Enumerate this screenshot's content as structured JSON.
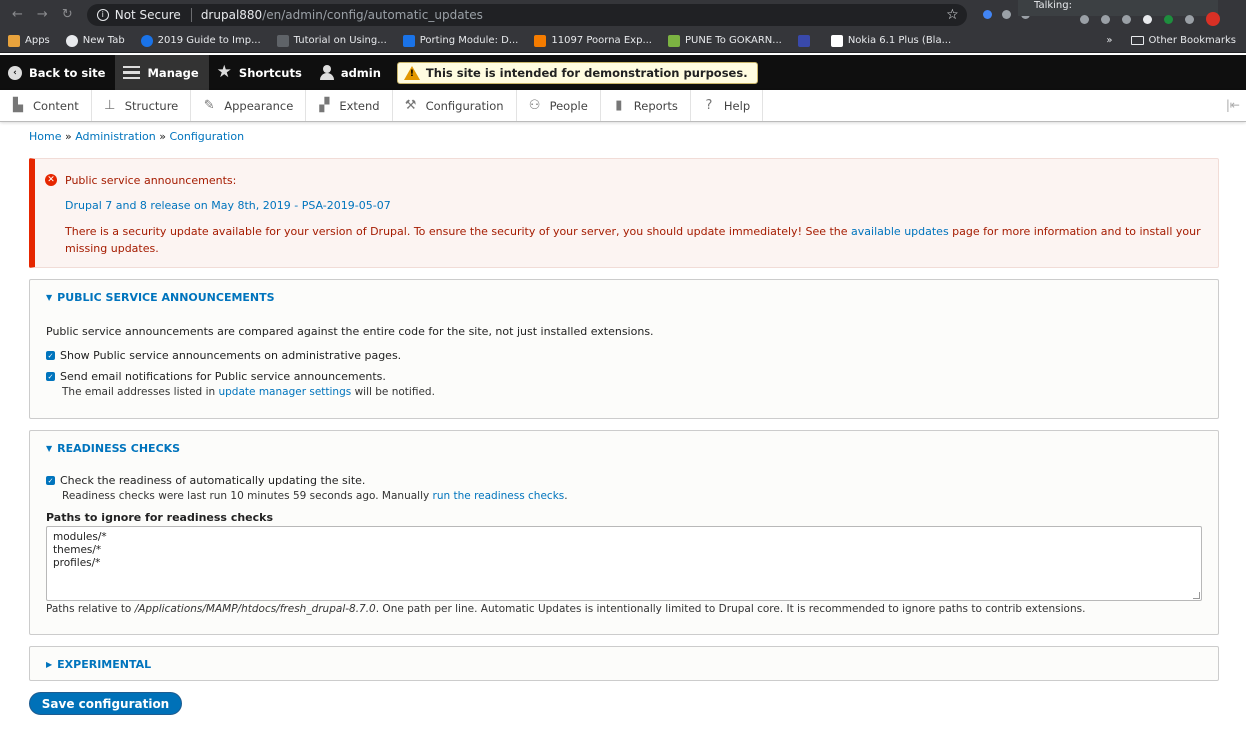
{
  "browser": {
    "not_secure": "Not Secure",
    "url_host": "drupal880",
    "url_path": "/en/admin/config/automatic_updates",
    "talking_label": "Talking:",
    "bookmarks": [
      {
        "label": "Apps",
        "color": "#e8a33d"
      },
      {
        "label": "New Tab",
        "color": "#e8eaed"
      },
      {
        "label": "2019 Guide to Imp...",
        "color": "#1a73e8"
      },
      {
        "label": "Tutorial on Using...",
        "color": "#5f6368"
      },
      {
        "label": "Porting Module: D...",
        "color": "#1a73e8"
      },
      {
        "label": "11097 Poorna Exp...",
        "color": "#f57c00"
      },
      {
        "label": "PUNE To GOKARN...",
        "color": "#7cb342"
      },
      {
        "label": "",
        "color": "#3949ab"
      },
      {
        "label": "Nokia 6.1 Plus (Bla...",
        "color": "#ffffff"
      }
    ],
    "more": "»",
    "other_bookmarks": "Other Bookmarks"
  },
  "toolbar": {
    "back_to_site": "Back to site",
    "manage": "Manage",
    "shortcuts": "Shortcuts",
    "user": "admin",
    "demo_notice": "This site is intended for demonstration purposes."
  },
  "tray": {
    "items": [
      {
        "label": "Content",
        "icon": "content-icon"
      },
      {
        "label": "Structure",
        "icon": "structure-icon"
      },
      {
        "label": "Appearance",
        "icon": "appearance-icon"
      },
      {
        "label": "Extend",
        "icon": "extend-icon"
      },
      {
        "label": "Configuration",
        "icon": "wrench-icon"
      },
      {
        "label": "People",
        "icon": "people-icon"
      },
      {
        "label": "Reports",
        "icon": "reports-icon"
      },
      {
        "label": "Help",
        "icon": "help-icon"
      }
    ]
  },
  "breadcrumb": {
    "home": "Home",
    "administration": "Administration",
    "configuration": "Configuration",
    "separator": "»"
  },
  "alert": {
    "title": "Public service announcements:",
    "link": "Drupal 7 and 8 release on May 8th, 2019 - PSA-2019-05-07",
    "text_before": "There is a security update available for your version of Drupal. To ensure the security of your server, you should update immediately! See the ",
    "text_link": "available updates",
    "text_after": " page for more information and to install your missing updates."
  },
  "psa": {
    "legend": "Public service announcements",
    "description": "Public service announcements are compared against the entire code for the site, not just installed extensions.",
    "show_label": "Show Public service announcements on administrative pages.",
    "email_label": "Send email notifications for Public service announcements.",
    "email_desc_before": "The email addresses listed in ",
    "email_desc_link": "update manager settings",
    "email_desc_after": " will be notified."
  },
  "readiness": {
    "legend": "Readiness checks",
    "check_label": "Check the readiness of automatically updating the site.",
    "check_desc_before": "Readiness checks were last run 10 minutes 59 seconds ago. Manually ",
    "check_desc_link": "run the readiness checks",
    "check_desc_after": ".",
    "paths_label": "Paths to ignore for readiness checks",
    "paths_value": "modules/*\nthemes/*\nprofiles/*",
    "help_before": "Paths relative to ",
    "help_path": "/Applications/MAMP/htdocs/fresh_drupal-8.7.0",
    "help_after": ". One path per line. Automatic Updates is intentionally limited to Drupal core. It is recommended to ignore paths to contrib extensions."
  },
  "experimental": {
    "legend": "Experimental"
  },
  "actions": {
    "save_label": "Save configuration"
  }
}
